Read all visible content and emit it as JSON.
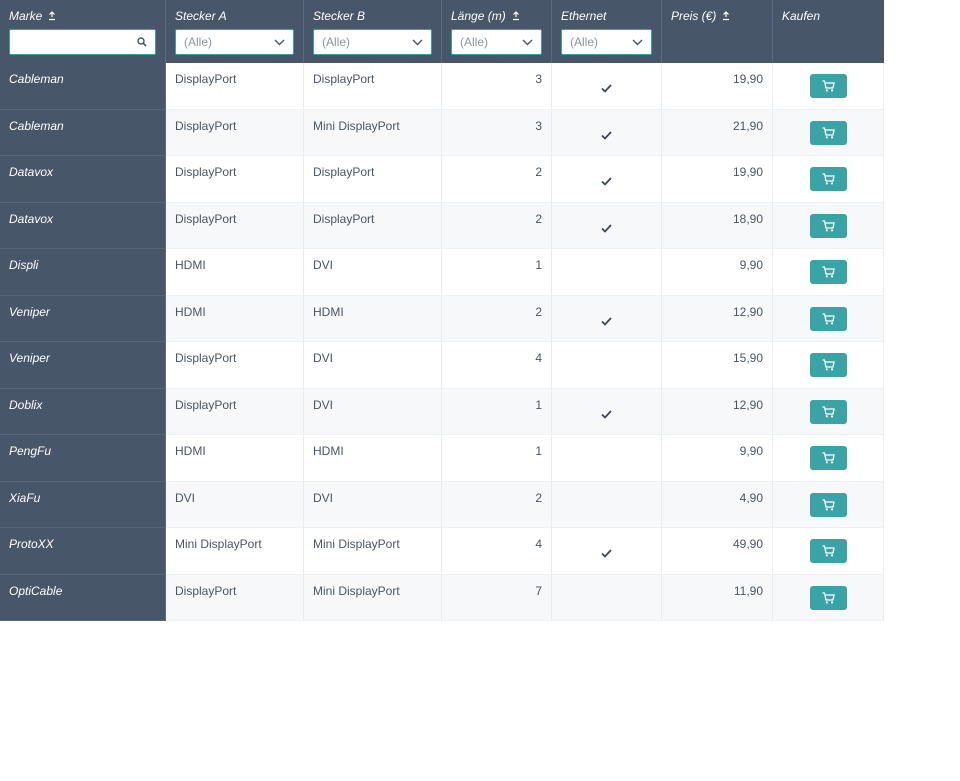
{
  "columns": {
    "marke": "Marke",
    "stecker_a": "Stecker A",
    "stecker_b": "Stecker B",
    "laenge": "Länge (m)",
    "ethernet": "Ethernet",
    "preis": "Preis (€)",
    "kaufen": "Kaufen"
  },
  "filters": {
    "marke_value": "",
    "stecker_a": "(Alle)",
    "stecker_b": "(Alle)",
    "laenge": "(Alle)",
    "ethernet": "(Alle)"
  },
  "icons": {
    "sort": "sort-icon",
    "search": "search-icon",
    "dropdown": "chevron-down-icon",
    "check": "check-icon",
    "cart": "cart-icon"
  },
  "colors": {
    "header_bg": "#475669",
    "accent": "#3aa3a6",
    "row_alt": "#f7f8fa"
  },
  "rows": [
    {
      "marke": "Cableman",
      "a": "DisplayPort",
      "b": "DisplayPort",
      "laenge": "3",
      "ethernet": true,
      "preis": "19,90"
    },
    {
      "marke": "Cableman",
      "a": "DisplayPort",
      "b": "Mini DisplayPort",
      "laenge": "3",
      "ethernet": true,
      "preis": "21,90"
    },
    {
      "marke": "Datavox",
      "a": "DisplayPort",
      "b": "DisplayPort",
      "laenge": "2",
      "ethernet": true,
      "preis": "19,90"
    },
    {
      "marke": "Datavox",
      "a": "DisplayPort",
      "b": "DisplayPort",
      "laenge": "2",
      "ethernet": true,
      "preis": "18,90"
    },
    {
      "marke": "Displi",
      "a": "HDMI",
      "b": "DVI",
      "laenge": "1",
      "ethernet": false,
      "preis": "9,90"
    },
    {
      "marke": "Veniper",
      "a": "HDMI",
      "b": "HDMI",
      "laenge": "2",
      "ethernet": true,
      "preis": "12,90"
    },
    {
      "marke": "Veniper",
      "a": "DisplayPort",
      "b": "DVI",
      "laenge": "4",
      "ethernet": false,
      "preis": "15,90"
    },
    {
      "marke": "Doblix",
      "a": "DisplayPort",
      "b": "DVI",
      "laenge": "1",
      "ethernet": true,
      "preis": "12,90"
    },
    {
      "marke": "PengFu",
      "a": "HDMI",
      "b": "HDMI",
      "laenge": "1",
      "ethernet": false,
      "preis": "9,90"
    },
    {
      "marke": "XiaFu",
      "a": "DVI",
      "b": "DVI",
      "laenge": "2",
      "ethernet": false,
      "preis": "4,90"
    },
    {
      "marke": "ProtoXX",
      "a": "Mini DisplayPort",
      "b": "Mini DisplayPort",
      "laenge": "4",
      "ethernet": true,
      "preis": "49,90"
    },
    {
      "marke": "OptiCable",
      "a": "DisplayPort",
      "b": "Mini DisplayPort",
      "laenge": "7",
      "ethernet": false,
      "preis": "11,90"
    }
  ]
}
